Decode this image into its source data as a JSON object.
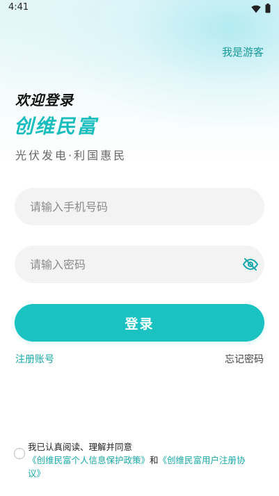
{
  "status_bar": {
    "time": "4:41",
    "icons": [
      "wifi-icon",
      "battery-icon"
    ]
  },
  "header": {
    "guest_link": "我是游客"
  },
  "hero": {
    "welcome": "欢迎登录",
    "brand": "创维民富",
    "slogan": "光伏发电·利国惠民"
  },
  "form": {
    "phone_placeholder": "请输入手机号码",
    "phone_value": "",
    "password_placeholder": "请输入密码",
    "password_value": "",
    "password_toggle_icon": "eye-off-icon",
    "login_label": "登录",
    "register_label": "注册账号",
    "forgot_label": "忘记密码"
  },
  "agreement": {
    "prefix": "我已认真阅读、理解并同意",
    "privacy_link": "《创维民富个人信息保护政策》",
    "conjunction": "和",
    "user_link": "《创维民富用户注册协议》",
    "checked": false
  },
  "colors": {
    "accent": "#1bc2c2",
    "link": "#1aa8a8",
    "field_bg": "#f3f3f3"
  }
}
